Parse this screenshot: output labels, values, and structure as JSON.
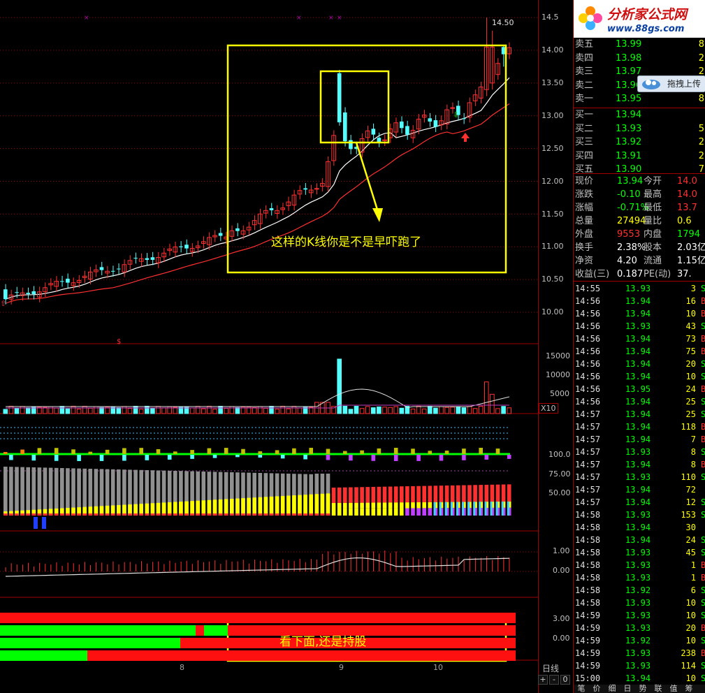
{
  "annotations": {
    "top_note": "这样的K线你是不是早吓跑了",
    "bottom_note": "看下面,还是持股",
    "peak_label": "14.50"
  },
  "logo": {
    "brand": "分析家公式网",
    "url": "www.88gs.com"
  },
  "upload_button": "拖拽上传",
  "price_axis": [
    "14.5",
    "14.00",
    "13.50",
    "13.00",
    "12.50",
    "12.00",
    "11.50",
    "11.00",
    "10.50",
    "10.00"
  ],
  "volume_axis": [
    "15000",
    "10000",
    "5000"
  ],
  "volume_unit": "X10",
  "indicator_axis": [
    "100.0",
    "75.00",
    "50.00"
  ],
  "osc_axis": [
    "1.00",
    "0.00"
  ],
  "bars_axis": [
    "3.00",
    "0.00"
  ],
  "period_label": "日线",
  "x_ticks": [
    "8",
    "9",
    "10"
  ],
  "zoom_buttons": [
    "+",
    "-",
    "0"
  ],
  "order_book": {
    "asks": [
      {
        "label": "卖五",
        "price": "13.99",
        "vol": "8"
      },
      {
        "label": "卖四",
        "price": "13.98",
        "vol": "2"
      },
      {
        "label": "卖三",
        "price": "13.97",
        "vol": "2"
      },
      {
        "label": "卖二",
        "price": "13.96",
        "vol": "2"
      },
      {
        "label": "卖一",
        "price": "13.95",
        "vol": "8"
      }
    ],
    "bids": [
      {
        "label": "买一",
        "price": "13.94",
        "vol": ""
      },
      {
        "label": "买二",
        "price": "13.93",
        "vol": "5"
      },
      {
        "label": "买三",
        "price": "13.92",
        "vol": "2"
      },
      {
        "label": "买四",
        "price": "13.91",
        "vol": "2"
      },
      {
        "label": "买五",
        "price": "13.90",
        "vol": "7"
      }
    ]
  },
  "quote": [
    {
      "l1": "现价",
      "v1": "13.94",
      "l2": "今开",
      "v2": "14.0"
    },
    {
      "l1": "涨跌",
      "v1": "-0.10",
      "l2": "最高",
      "v2": "14.0"
    },
    {
      "l1": "涨幅",
      "v1": "-0.71%",
      "l2": "最低",
      "v2": "13.7"
    },
    {
      "l1": "总量",
      "v1": "27494",
      "l2": "量比",
      "v2": "0.6"
    },
    {
      "l1": "外盘",
      "v1": "9553",
      "l2": "内盘",
      "v2": "1794"
    },
    {
      "l1": "换手",
      "v1": "2.38%",
      "l2": "股本",
      "v2": "2.03亿"
    },
    {
      "l1": "净资",
      "v1": "4.20",
      "l2": "流通",
      "v2": "1.15亿"
    },
    {
      "l1": "收益(三)",
      "v1": "0.187",
      "l2": "PE(动)",
      "v2": "37."
    }
  ],
  "trades": [
    {
      "t": "14:55",
      "p": "13.93",
      "v": "3",
      "d": "S"
    },
    {
      "t": "14:56",
      "p": "13.94",
      "v": "16",
      "d": "B"
    },
    {
      "t": "14:56",
      "p": "13.94",
      "v": "10",
      "d": "B"
    },
    {
      "t": "14:56",
      "p": "13.93",
      "v": "43",
      "d": "S"
    },
    {
      "t": "14:56",
      "p": "13.94",
      "v": "73",
      "d": "B"
    },
    {
      "t": "14:56",
      "p": "13.94",
      "v": "75",
      "d": "B"
    },
    {
      "t": "14:56",
      "p": "13.94",
      "v": "20",
      "d": "S"
    },
    {
      "t": "14:56",
      "p": "13.94",
      "v": "10",
      "d": "S"
    },
    {
      "t": "14:56",
      "p": "13.95",
      "v": "24",
      "d": "B"
    },
    {
      "t": "14:56",
      "p": "13.94",
      "v": "25",
      "d": "S"
    },
    {
      "t": "14:57",
      "p": "13.94",
      "v": "25",
      "d": "S"
    },
    {
      "t": "14:57",
      "p": "13.94",
      "v": "118",
      "d": "B"
    },
    {
      "t": "14:57",
      "p": "13.94",
      "v": "7",
      "d": "B"
    },
    {
      "t": "14:57",
      "p": "13.93",
      "v": "8",
      "d": "S"
    },
    {
      "t": "14:57",
      "p": "13.94",
      "v": "8",
      "d": "B"
    },
    {
      "t": "14:57",
      "p": "13.93",
      "v": "110",
      "d": "S"
    },
    {
      "t": "14:57",
      "p": "13.94",
      "v": "72",
      "d": ""
    },
    {
      "t": "14:57",
      "p": "13.94",
      "v": "12",
      "d": "S"
    },
    {
      "t": "14:58",
      "p": "13.93",
      "v": "153",
      "d": "S"
    },
    {
      "t": "14:58",
      "p": "13.94",
      "v": "30",
      "d": ""
    },
    {
      "t": "14:58",
      "p": "13.94",
      "v": "24",
      "d": "S"
    },
    {
      "t": "14:58",
      "p": "13.93",
      "v": "45",
      "d": "S"
    },
    {
      "t": "14:58",
      "p": "13.93",
      "v": "1",
      "d": "B"
    },
    {
      "t": "14:58",
      "p": "13.93",
      "v": "1",
      "d": "B"
    },
    {
      "t": "14:58",
      "p": "13.92",
      "v": "6",
      "d": "S"
    },
    {
      "t": "14:58",
      "p": "13.93",
      "v": "10",
      "d": "S"
    },
    {
      "t": "14:59",
      "p": "13.93",
      "v": "10",
      "d": "S"
    },
    {
      "t": "14:59",
      "p": "13.93",
      "v": "20",
      "d": "B"
    },
    {
      "t": "14:59",
      "p": "13.92",
      "v": "10",
      "d": "S"
    },
    {
      "t": "14:59",
      "p": "13.93",
      "v": "238",
      "d": "B"
    },
    {
      "t": "14:59",
      "p": "13.93",
      "v": "114",
      "d": "S"
    },
    {
      "t": "15:00",
      "p": "13.94",
      "v": "10",
      "d": "S"
    }
  ],
  "bottom_tabs": [
    "笔",
    "价",
    "细",
    "日",
    "势",
    "联",
    "值",
    "筹"
  ],
  "colors": {
    "up": "#ff3030",
    "down": "#54ffff",
    "ma1": "#ffffff",
    "ma2": "#ff3030",
    "annot": "#ffff00",
    "grid": "#a00000",
    "green": "#00ff00"
  }
}
